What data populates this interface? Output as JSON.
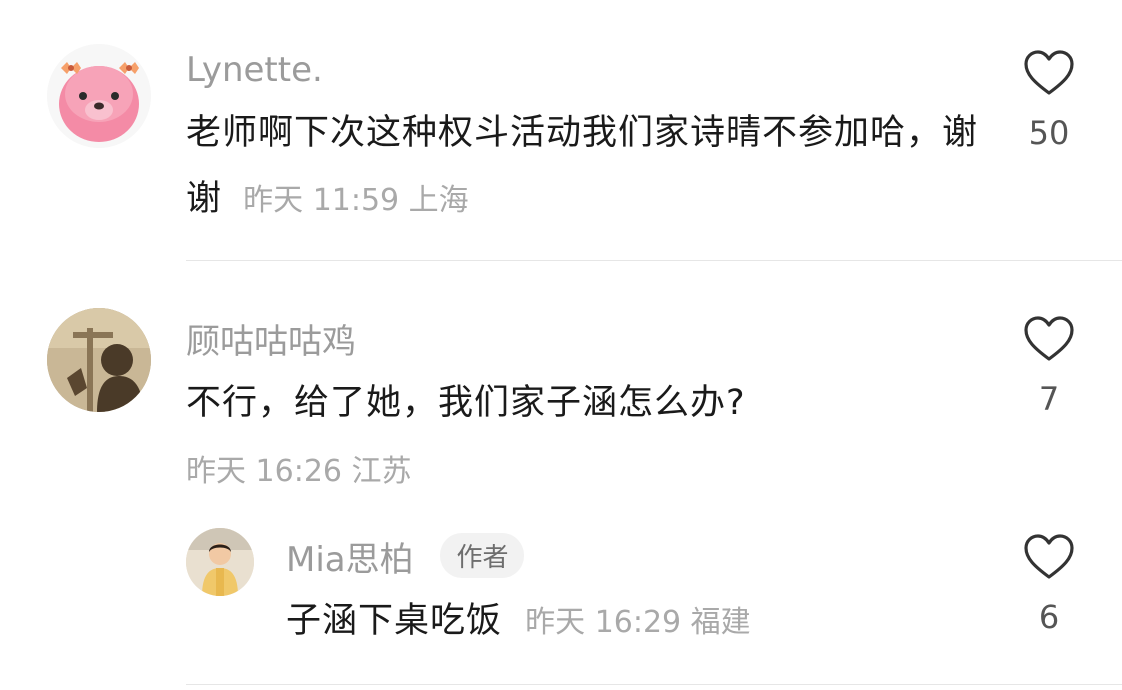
{
  "comments": [
    {
      "username": "Lynette.",
      "text": "老师啊下次这种权斗活动我们家诗晴不参加哈，谢谢",
      "meta": "昨天 11:59 上海",
      "likes": "50"
    },
    {
      "username": "顾咕咕咕鸡",
      "text": "不行，给了她，我们家子涵怎么办?",
      "meta": "昨天 16:26 江苏",
      "likes": "7"
    }
  ],
  "reply": {
    "username": "Mia思柏",
    "badge": "作者",
    "text": "子涵下桌吃饭",
    "meta": "昨天 16:29 福建",
    "likes": "6"
  },
  "colors": {
    "username": "#9b9b9b",
    "text": "#1a1a1a",
    "meta": "#a9a9a9",
    "avatar_pink": "#f48ba6"
  }
}
